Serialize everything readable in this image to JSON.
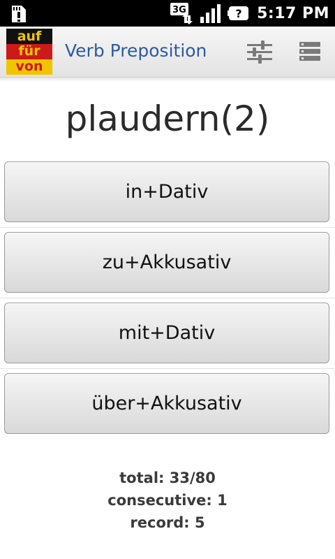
{
  "status_bar": {
    "network_type": "3G",
    "time": "5:17 PM",
    "icons": [
      "sd-card-warning-icon",
      "3g-data-icon",
      "signal-strength-icon",
      "battery-unknown-icon"
    ]
  },
  "app_bar": {
    "logo_words": [
      "auf",
      "für",
      "von"
    ],
    "title": "Verb Preposition",
    "actions": [
      "settings-sliders-icon",
      "menu-list-icon"
    ]
  },
  "quiz": {
    "word": "plaudern(2)",
    "answers": [
      "in+Dativ",
      "zu+Akkusativ",
      "mit+Dativ",
      "über+Akkusativ"
    ]
  },
  "stats": {
    "total": "total: 33/80",
    "consecutive": "consecutive: 1",
    "record": "record: 5"
  },
  "colors": {
    "status_bar_bg": "#000000",
    "app_title": "#2d5aa0",
    "flag_black": "#111111",
    "flag_red": "#cc1a1a",
    "flag_gold": "#f2c400"
  }
}
